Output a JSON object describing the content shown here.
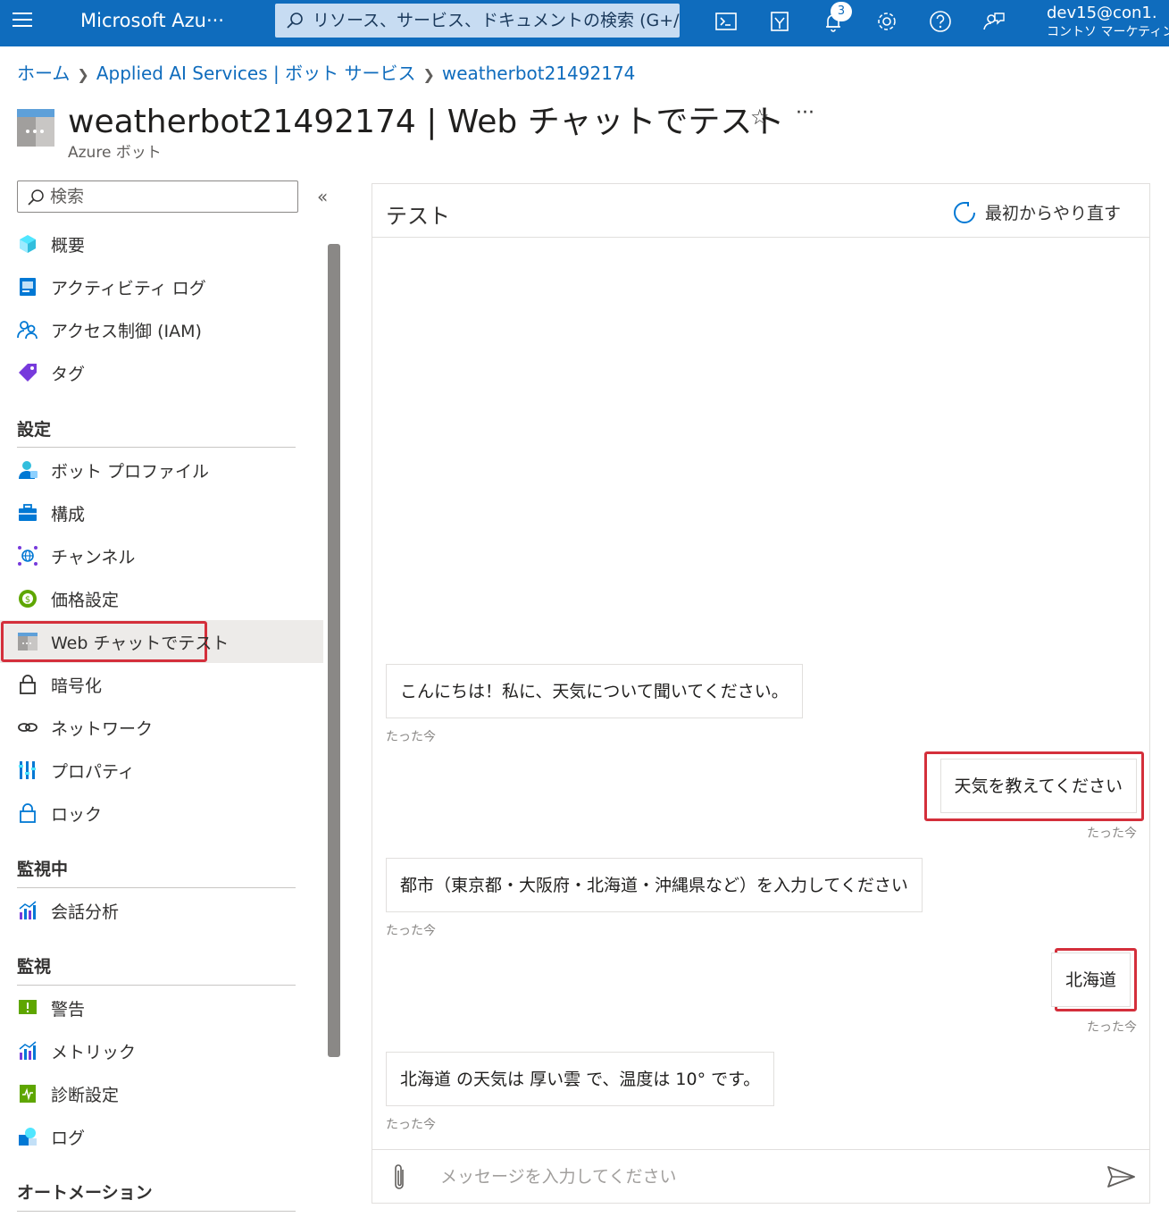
{
  "topbar": {
    "brand": "Microsoft Azu···",
    "search_placeholder": "リソース、サービス、ドキュメントの検索 (G+/)",
    "notification_count": "3",
    "user_name": "dev15@con1.",
    "user_org": "コントソ マーケティング"
  },
  "breadcrumb": {
    "items": [
      "ホーム",
      "Applied AI Services | ボット サービス",
      "weatherbot21492174"
    ]
  },
  "page": {
    "title": "weatherbot21492174 | Web チャットでテスト",
    "subtitle": "Azure ボット",
    "more": "···",
    "star": "☆"
  },
  "sidebar": {
    "search_placeholder": "検索",
    "collapse": "«",
    "items": [
      {
        "label": "概要",
        "icon": "cube-icon"
      },
      {
        "label": "アクティビティ ログ",
        "icon": "activity-log-icon"
      },
      {
        "label": "アクセス制御 (IAM)",
        "icon": "people-icon"
      },
      {
        "label": "タグ",
        "icon": "tag-icon"
      }
    ],
    "section_settings": "設定",
    "settings_items": [
      {
        "label": "ボット プロファイル",
        "icon": "bot-profile-icon"
      },
      {
        "label": "構成",
        "icon": "toolbox-icon"
      },
      {
        "label": "チャンネル",
        "icon": "network-globe-icon"
      },
      {
        "label": "価格設定",
        "icon": "pricing-icon"
      },
      {
        "label": "Web チャットでテスト",
        "icon": "webchat-icon"
      },
      {
        "label": "暗号化",
        "icon": "lock-icon"
      },
      {
        "label": "ネットワーク",
        "icon": "link-icon"
      },
      {
        "label": "プロパティ",
        "icon": "properties-icon"
      },
      {
        "label": "ロック",
        "icon": "lock-icon"
      }
    ],
    "section_monitoring_active": "監視中",
    "monitoring_active_items": [
      {
        "label": "会話分析",
        "icon": "chart-icon"
      }
    ],
    "section_monitoring": "監視",
    "monitoring_items": [
      {
        "label": "警告",
        "icon": "alert-icon"
      },
      {
        "label": "メトリック",
        "icon": "metrics-icon"
      },
      {
        "label": "診断設定",
        "icon": "diagnostics-icon"
      },
      {
        "label": "ログ",
        "icon": "logs-icon"
      }
    ],
    "section_automation": "オートメーション"
  },
  "chat": {
    "title": "テスト",
    "restart_label": "最初からやり直す",
    "messages": [
      {
        "from": "bot",
        "text": "こんにちは！私に、天気について聞いてください。",
        "time": "たった今"
      },
      {
        "from": "user",
        "text": "天気を教えてください",
        "time": "たった今"
      },
      {
        "from": "bot",
        "text": "都市（東京都・大阪府・北海道・沖縄県など）を入力してください",
        "time": "たった今"
      },
      {
        "from": "user",
        "text": "北海道",
        "time": "たった今"
      },
      {
        "from": "bot",
        "text": "北海道 の天気は 厚い雲 で、温度は 10° です。",
        "time": "たった今"
      }
    ],
    "input_placeholder": "メッセージを入力してください"
  },
  "colors": {
    "topbar": "#0f6cbd",
    "link": "#0f6cbd",
    "highlight": "#d42f3b",
    "active_nav": "#edebe9"
  }
}
